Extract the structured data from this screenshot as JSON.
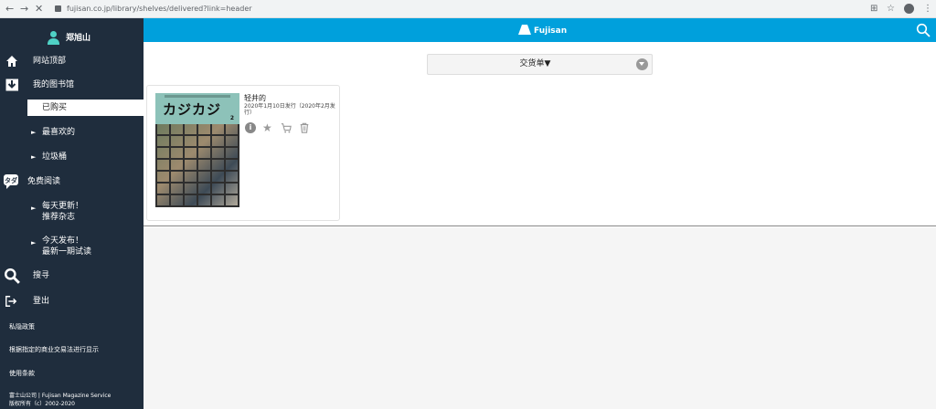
{
  "browser": {
    "url": "fujisan.co.jp/library/shelves/delivered?link=header",
    "back_icon": "←",
    "forward_icon": "→",
    "close_icon": "✕",
    "translate_icon": "⊞",
    "star_icon": "☆",
    "menu_icon": "⋮"
  },
  "sidebar": {
    "user_name": "郑旭山",
    "items": [
      {
        "label": "网站顶部",
        "icon": "home-icon"
      },
      {
        "label": "我的图书馆",
        "icon": "download-icon"
      },
      {
        "label": "已购买",
        "selected": true
      },
      {
        "label": "最喜欢的",
        "arrow": "►"
      },
      {
        "label": "垃圾桶",
        "arrow": "►"
      },
      {
        "label": "免费阅读",
        "icon": "free-read-icon"
      },
      {
        "label_line1": "每天更新！",
        "label_line2": "推荐杂志",
        "arrow": "►"
      },
      {
        "label_line1": "今天发布！",
        "label_line2": "最新一期试读",
        "arrow": "►"
      },
      {
        "label": "搜寻",
        "icon": "search-icon"
      },
      {
        "label": "登出",
        "icon": "logout-icon"
      }
    ],
    "footer_links": [
      "私隐政策",
      "根据指定的商业交易法进行显示",
      "使用条款"
    ],
    "copyright_line1": "富士山公司 | Fujisan Magazine Service",
    "copyright_line2": "版权所有（c）2002-2020"
  },
  "header": {
    "brand": "Fujisan"
  },
  "main": {
    "dropdown_label": "交货单▼",
    "book": {
      "title": "轻井的",
      "meta": "2020年1月10日发行（2020年2月发行）",
      "cover_title": "カジカジ",
      "cover_no": "2"
    }
  },
  "colors": {
    "sidebar_bg": "#1f2d3d",
    "header_bg": "#00a0dc",
    "accent": "#4fd1c5"
  }
}
